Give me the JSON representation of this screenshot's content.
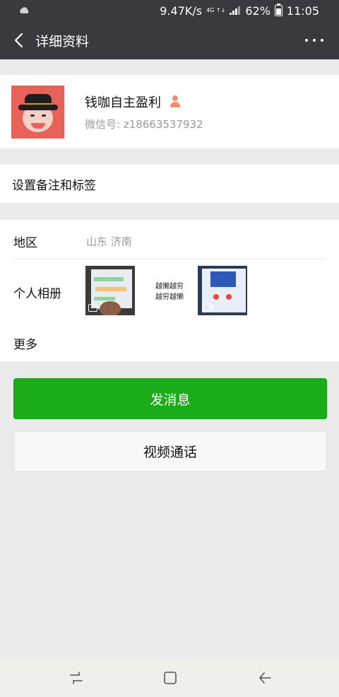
{
  "status_bar": {
    "speed": "9.47K/s",
    "network_top": "4G",
    "network_bottom": "↑↓",
    "battery": "62%",
    "time": "11:05"
  },
  "header": {
    "title": "详细资料"
  },
  "profile": {
    "nickname": "钱咖自主盈利",
    "wechat_id": "微信号: z18663537932"
  },
  "remark": {
    "label": "设置备注和标签"
  },
  "info": {
    "region_label": "地区",
    "region_value": "山东  济南",
    "album_label": "个人相册",
    "album_text_line1": "越懒越穷",
    "album_text_line2": "越穷越懒",
    "more_label": "更多"
  },
  "actions": {
    "send_message": "发消息",
    "video_call": "视频通话"
  },
  "colors": {
    "header_bg": "#393a3f",
    "primary_green": "#1aad19",
    "page_bg": "#ebebeb"
  }
}
